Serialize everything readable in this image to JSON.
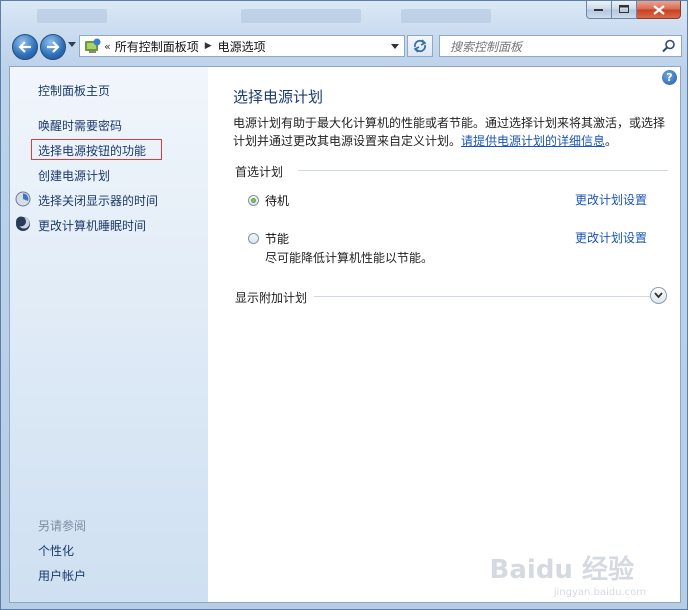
{
  "window": {
    "controls": {
      "minimize": "minimize",
      "maximize": "maximize",
      "close": "close"
    }
  },
  "nav": {
    "overflow": "«",
    "breadcrumb": [
      "所有控制面板项",
      "电源选项"
    ],
    "search_placeholder": "搜索控制面板"
  },
  "sidebar": {
    "home": "控制面板主页",
    "links": [
      {
        "label": "唤醒时需要密码",
        "icon": null
      },
      {
        "label": "选择电源按钮的功能",
        "icon": null,
        "highlighted": true
      },
      {
        "label": "创建电源计划",
        "icon": null
      },
      {
        "label": "选择关闭显示器的时间",
        "icon": "monitor-icon"
      },
      {
        "label": "更改计算机睡眠时间",
        "icon": "moon-icon"
      }
    ],
    "see_also_header": "另请参阅",
    "see_also": [
      "个性化",
      "用户帐户"
    ]
  },
  "main": {
    "title": "选择电源计划",
    "description_line": "电源计划有助于最大化计算机的性能或者节能。通过选择计划来将其激活，或选择计划并通过更改其电源设置来自定义计划。",
    "description_link": "请提供电源计划的详细信息",
    "description_end": "。",
    "preferred_label": "首选计划",
    "plans": [
      {
        "name": "待机",
        "selected": true,
        "change_link": "更改计划设置",
        "desc": ""
      },
      {
        "name": "节能",
        "selected": false,
        "change_link": "更改计划设置",
        "desc": "尽可能降低计算机性能以节能。"
      }
    ],
    "more_plans_label": "显示附加计划"
  },
  "watermark": {
    "text": "Baidu 经验",
    "sub": "jingyan.baidu.com"
  },
  "colors": {
    "link": "#1a55b8",
    "highlight_border": "#e23a3a",
    "title": "#1a3b74"
  }
}
